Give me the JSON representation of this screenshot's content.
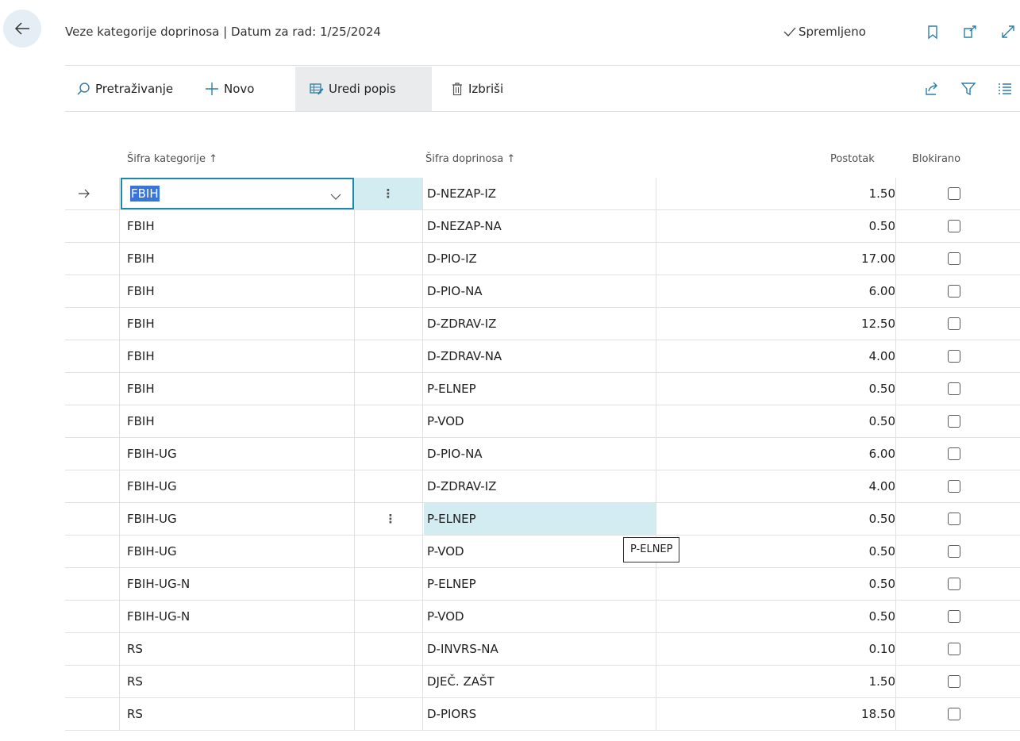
{
  "header": {
    "title": "Veze kategorije doprinosa | Datum za rad: 1/25/2024",
    "saved_label": "Spremljeno",
    "icons": [
      "back-arrow-icon",
      "bookmark-icon",
      "open-new-window-icon",
      "expand-icon"
    ]
  },
  "toolbar": {
    "search_label": "Pretraživanje",
    "new_label": "Novo",
    "edit_list_label": "Uredi popis",
    "delete_label": "Izbriši",
    "right_icons": [
      "share-icon",
      "filter-icon",
      "list-view-icon"
    ]
  },
  "columns": {
    "category": "Šifra kategorije",
    "contribution": "Šifra doprinosa",
    "percent": "Postotak",
    "blocked": "Blokirano",
    "sort_indicator": "↑"
  },
  "rows": [
    {
      "category": "FBIH",
      "contribution": "D-NEZAP-IZ",
      "percent": "1.50",
      "blocked": false
    },
    {
      "category": "FBIH",
      "contribution": "D-NEZAP-NA",
      "percent": "0.50",
      "blocked": false
    },
    {
      "category": "FBIH",
      "contribution": "D-PIO-IZ",
      "percent": "17.00",
      "blocked": false
    },
    {
      "category": "FBIH",
      "contribution": "D-PIO-NA",
      "percent": "6.00",
      "blocked": false
    },
    {
      "category": "FBIH",
      "contribution": "D-ZDRAV-IZ",
      "percent": "12.50",
      "blocked": false
    },
    {
      "category": "FBIH",
      "contribution": "D-ZDRAV-NA",
      "percent": "4.00",
      "blocked": false
    },
    {
      "category": "FBIH",
      "contribution": "P-ELNEP",
      "percent": "0.50",
      "blocked": false
    },
    {
      "category": "FBIH",
      "contribution": "P-VOD",
      "percent": "0.50",
      "blocked": false
    },
    {
      "category": "FBIH-UG",
      "contribution": "D-PIO-NA",
      "percent": "6.00",
      "blocked": false
    },
    {
      "category": "FBIH-UG",
      "contribution": "D-ZDRAV-IZ",
      "percent": "4.00",
      "blocked": false
    },
    {
      "category": "FBIH-UG",
      "contribution": "P-ELNEP",
      "percent": "0.50",
      "blocked": false
    },
    {
      "category": "FBIH-UG",
      "contribution": "P-VOD",
      "percent": "0.50",
      "blocked": false
    },
    {
      "category": "FBIH-UG-N",
      "contribution": "P-ELNEP",
      "percent": "0.50",
      "blocked": false
    },
    {
      "category": "FBIH-UG-N",
      "contribution": "P-VOD",
      "percent": "0.50",
      "blocked": false
    },
    {
      "category": "RS",
      "contribution": "D-INVRS-NA",
      "percent": "0.10",
      "blocked": false
    },
    {
      "category": "RS",
      "contribution": "DJEČ. ZAŠT",
      "percent": "1.50",
      "blocked": false
    },
    {
      "category": "RS",
      "contribution": "D-PIORS",
      "percent": "18.50",
      "blocked": false
    }
  ],
  "tooltip": "P-ELNEP",
  "colors": {
    "accent": "#1a8aa8",
    "highlight": "#d3ecf1",
    "selection": "#3875d7"
  }
}
